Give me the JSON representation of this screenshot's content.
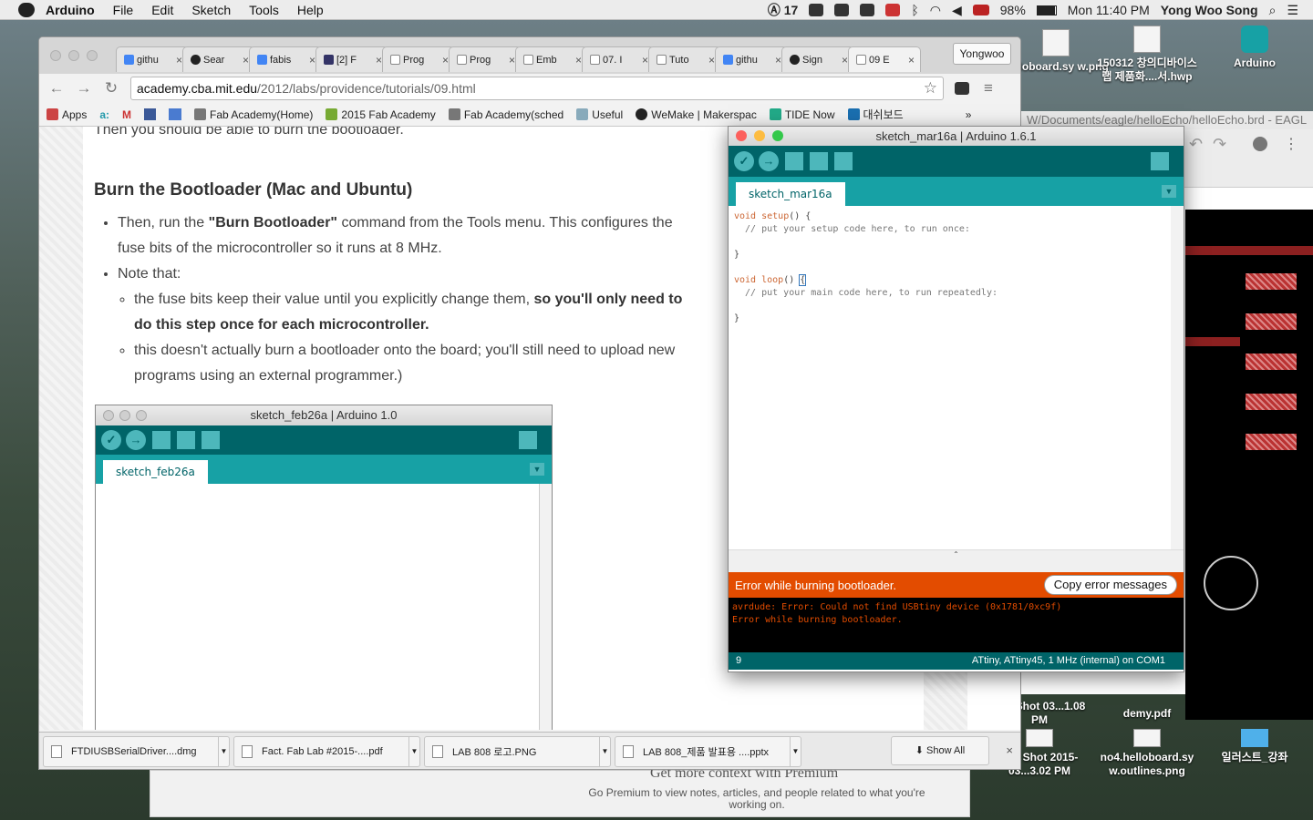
{
  "menubar": {
    "app": "Arduino",
    "items": [
      "File",
      "Edit",
      "Sketch",
      "Tools",
      "Help"
    ],
    "adobe_count": "17",
    "battery": "98%",
    "clock": "Mon 11:40 PM",
    "user": "Yong Woo Song"
  },
  "desktop": {
    "icons": [
      {
        "label": "helloboard.sy w.png",
        "name": "desktop-file-helloboard-png"
      },
      {
        "label": "150312 창의디바이스랩 제품화....서.hwp",
        "name": "desktop-file-hwp"
      },
      {
        "label": "Arduino",
        "name": "desktop-app-arduino"
      },
      {
        "label": "een Shot 03...1.08 PM",
        "name": "desktop-file-screenshot-1"
      },
      {
        "label": "demy.pdf",
        "name": "desktop-file-pdf"
      },
      {
        "label": "een Shot 2015-03...3.02 PM",
        "name": "desktop-file-screenshot-2"
      },
      {
        "label": "no4.helloboard.sy w.outlines.png",
        "name": "desktop-file-outlines-png"
      },
      {
        "label": "일러스트_강좌",
        "name": "desktop-folder-illustrator"
      }
    ]
  },
  "browser": {
    "tabs": [
      "githu",
      "Sear",
      "fabis",
      "[2] F",
      "Prog",
      "Prog",
      "Emb",
      "07. I",
      "Tuto",
      "githu",
      "Sign",
      "09 E"
    ],
    "profile": "Yongwoo",
    "url_host": "academy.cba.mit.edu",
    "url_path": "/2012/labs/providence/tutorials/09.html",
    "bookmarks": [
      "Apps",
      "Fab Academy(Home)",
      "2015 Fab Academy",
      "Fab Academy(sched",
      "Useful",
      "WeMake | Makerspac",
      "TIDE Now",
      "대쉬보드"
    ],
    "more": "»"
  },
  "article": {
    "intro": "Then you should be able to burn the bootloader.",
    "heading": "Burn the Bootloader (Mac and Ubuntu)",
    "b1_pre": "Then, run the ",
    "b1_bold": "\"Burn Bootloader\"",
    "b1_post": " command from the Tools menu. This configures the fuse bits of the microcontroller so it runs at 8 MHz.",
    "b2": "Note that:",
    "s1_pre": "the fuse bits keep their value until you explicitly change them, ",
    "s1_bold": "so you'll only need to do this step once for each microcontroller.",
    "s2": "this doesn't actually burn a bootloader onto the board; you'll still need to upload new programs using an external programmer.)"
  },
  "embedded_shot": {
    "title": "sketch_feb26a | Arduino 1.0",
    "tab": "sketch_feb26a"
  },
  "downloads": {
    "items": [
      "FTDIUSBSerialDriver....dmg",
      "Fact. Fab Lab #2015-....pdf",
      "LAB 808 로고.PNG",
      "LAB 808_제품 발표용 ....pptx"
    ],
    "show_all": "Show All",
    "close": "×"
  },
  "underlying": {
    "promo_title": "Get more context with Premium",
    "promo_text": "Go Premium to view notes, articles, and people related to what you're working on."
  },
  "eagle": {
    "title": "W/Documents/eagle/helloEcho/helloEcho.brd - EAGL"
  },
  "arduino": {
    "title": "sketch_mar16a | Arduino 1.6.1",
    "tab": "sketch_mar16a",
    "code": {
      "l1_kw": "void",
      "l1_fn": "setup",
      "l1_rest": "() {",
      "l2": "  // put your setup code here, to run once:",
      "l4": "}",
      "l6_kw": "void",
      "l6_fn": "loop",
      "l6_rest": "() ",
      "l6_brace": "{",
      "l7": "  // put your main code here, to run repeatedly:",
      "l9": "}"
    },
    "error_title": "Error while burning bootloader.",
    "copy_button": "Copy error messages",
    "console": [
      "avrdude: Error: Could not find USBtiny device (0x1781/0xc9f)",
      "Error while burning bootloader."
    ],
    "line_number": "9",
    "board": "ATtiny, ATtiny45, 1 MHz (internal) on COM1"
  },
  "colors": {
    "arduino_teal_dark": "#006468",
    "arduino_teal": "#17a1a5",
    "error_orange": "#e34c00"
  }
}
